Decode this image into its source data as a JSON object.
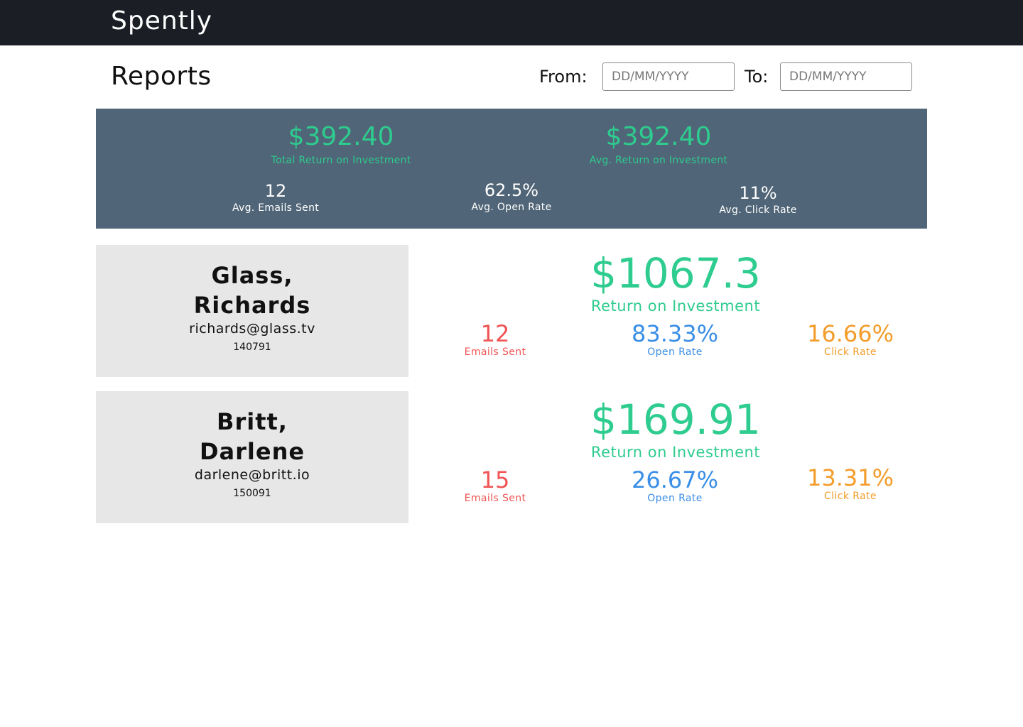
{
  "app": {
    "brand": "Spently"
  },
  "header": {
    "title": "Reports",
    "from_label": "From:",
    "to_label": "To:",
    "from_placeholder": "DD/MM/YYYY",
    "to_placeholder": "DD/MM/YYYY"
  },
  "summary": {
    "total_roi": {
      "value": "$392.40",
      "label": "Total Return on Investment"
    },
    "avg_roi": {
      "value": "$392.40",
      "label": "Avg. Return on Investment"
    },
    "avg_emails": {
      "value": "12",
      "label": "Avg. Emails Sent"
    },
    "avg_open": {
      "value": "62.5%",
      "label": "Avg. Open Rate"
    },
    "avg_click": {
      "value": "11%",
      "label": "Avg. Click Rate"
    }
  },
  "clients": [
    {
      "name_line1": "Glass,",
      "name_line2": "Richards",
      "email": "richards@glass.tv",
      "id": "140791",
      "roi": "$1067.3",
      "roi_label": "Return on Investment",
      "emails_sent": "12",
      "emails_sent_label": "Emails Sent",
      "open_rate": "83.33%",
      "open_rate_label": "Open Rate",
      "click_rate": "16.66%",
      "click_rate_label": "Click Rate"
    },
    {
      "name_line1": "Britt,",
      "name_line2": "Darlene",
      "email": "darlene@britt.io",
      "id": "150091",
      "roi": "$169.91",
      "roi_label": "Return on Investment",
      "emails_sent": "15",
      "emails_sent_label": "Emails Sent",
      "open_rate": "26.67%",
      "open_rate_label": "Open Rate",
      "click_rate": "13.31%",
      "click_rate_label": "Click Rate"
    }
  ],
  "colors": {
    "topbar": "#1b1f25",
    "summary_bg": "#506577",
    "roi_green": "#2ecc8f",
    "emails_red": "#f05454",
    "open_blue": "#3a8ee6",
    "click_orange": "#f39c2a",
    "card_bg": "#e7e7e7"
  }
}
